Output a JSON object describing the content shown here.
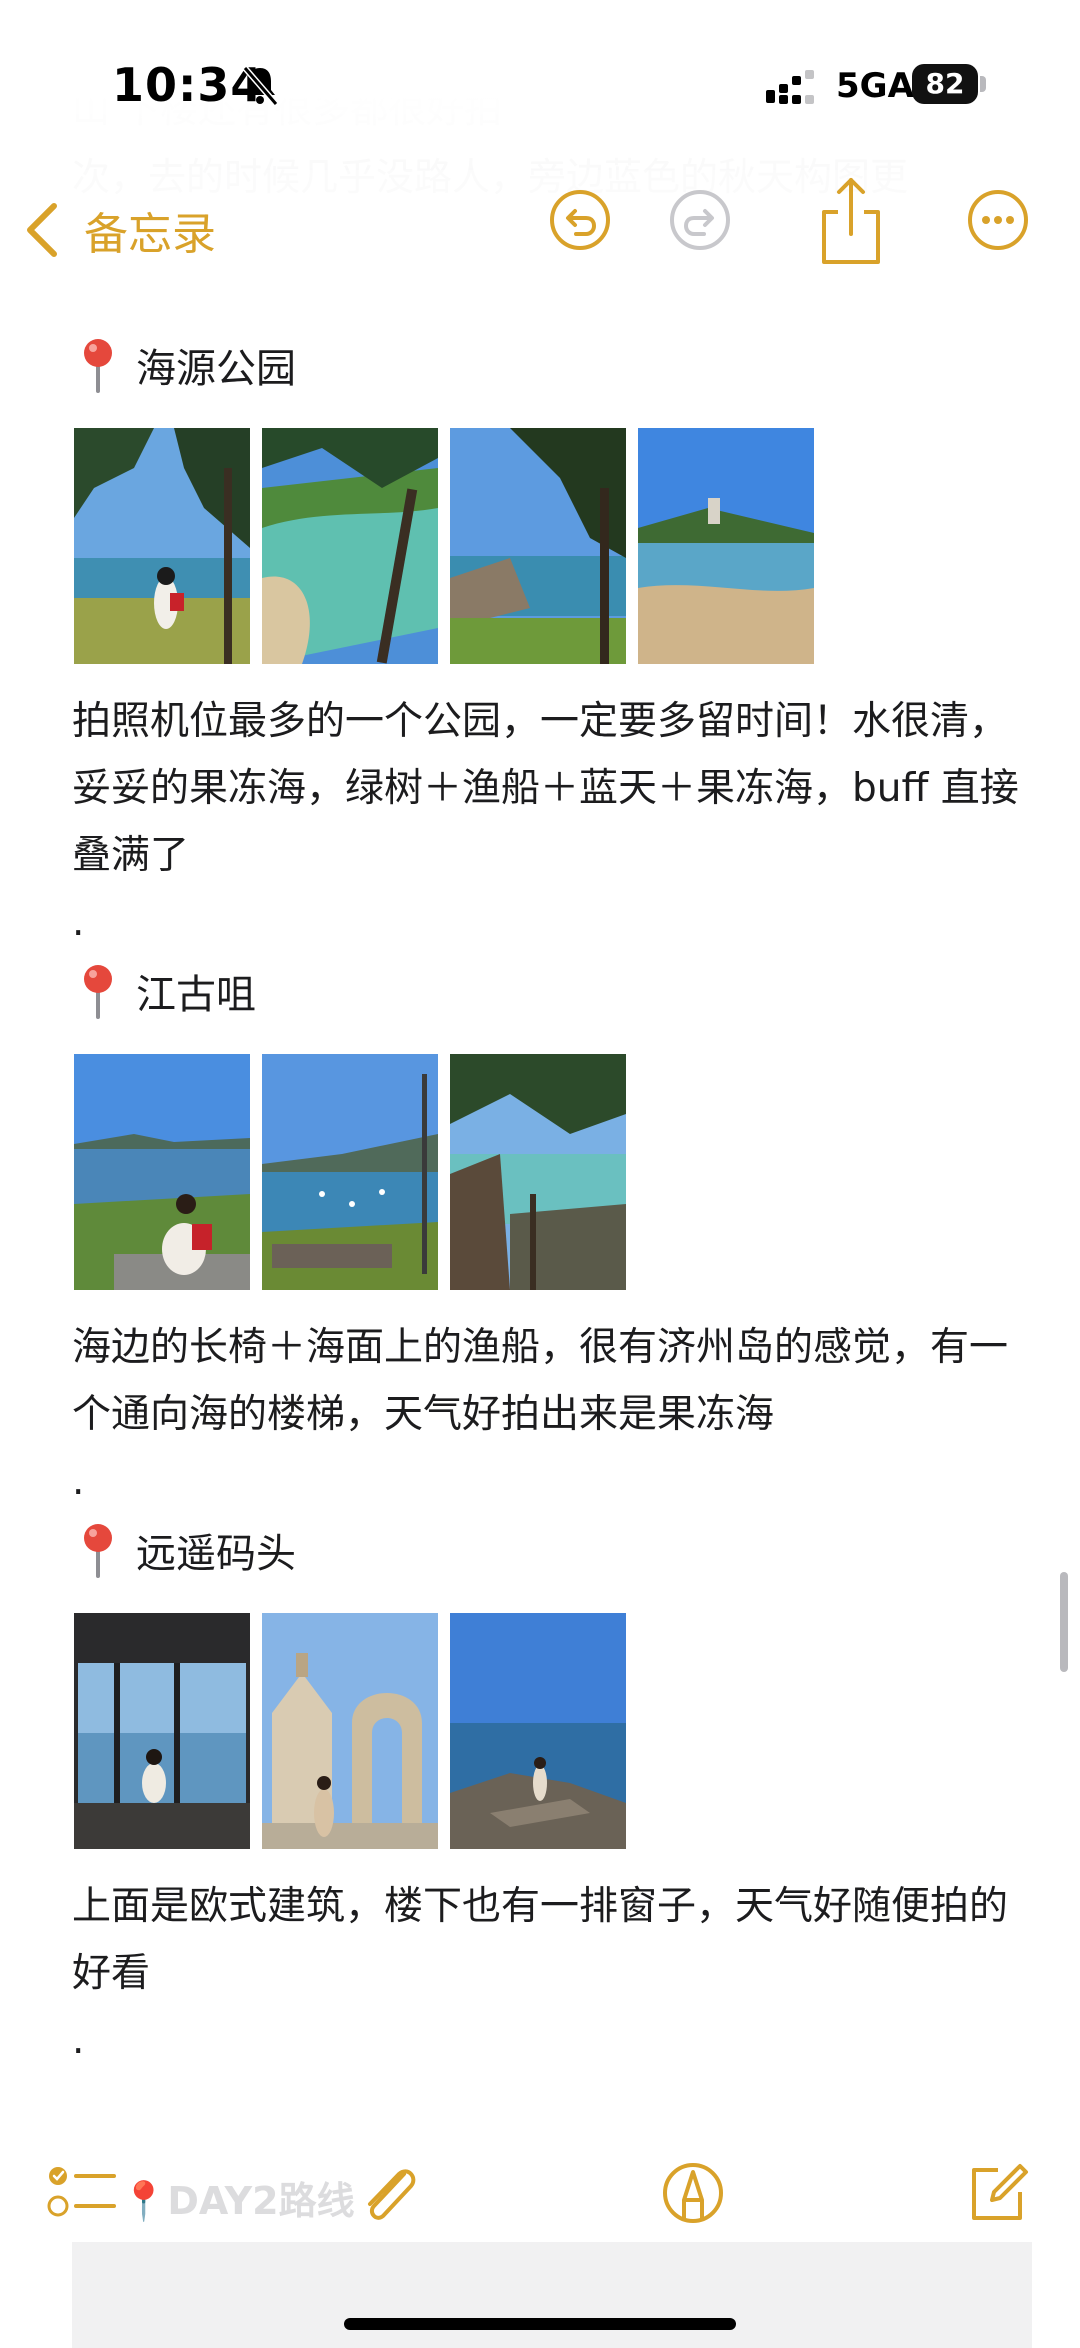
{
  "status_bar": {
    "time": "10:34",
    "network": "5GA",
    "battery": "82"
  },
  "nav": {
    "back_label": "备忘录"
  },
  "faded_top": {
    "line1": "山              下楼还有很多都很好拍",
    "line2": "次，去的时候几乎没路人，旁边蓝色的秋天构图更"
  },
  "sections": [
    {
      "title": "海源公园",
      "photos": [
        "pine-beach-woman-1",
        "beach-cove-2",
        "pine-rocks-3",
        "beach-tower-4"
      ],
      "desc": "拍照机位最多的一个公园，一定要多留时间！水很清，妥妥的果冻海，绿树＋渔船＋蓝天＋果冻海，buff 直接叠满了",
      "dot": "."
    },
    {
      "title": "江古咀",
      "photos": [
        "bench-woman-1",
        "boats-bay-2",
        "stairs-sea-3"
      ],
      "desc": "海边的长椅＋海面上的渔船，很有济州岛的感觉，有一个通向海的楼梯，天气好拍出来是果冻海",
      "dot": "."
    },
    {
      "title": "远遥码头",
      "photos": [
        "window-sea-1",
        "european-arch-2",
        "pier-rocks-3"
      ],
      "desc": "上面是欧式建筑，楼下也有一排窗子，天气好随便拍的好看",
      "dot": "."
    }
  ],
  "bottom_ghost": "📍DAY2路线",
  "colors": {
    "accent": "#D9A22A",
    "text": "#1C1C1E",
    "pin": "#E5483C"
  }
}
